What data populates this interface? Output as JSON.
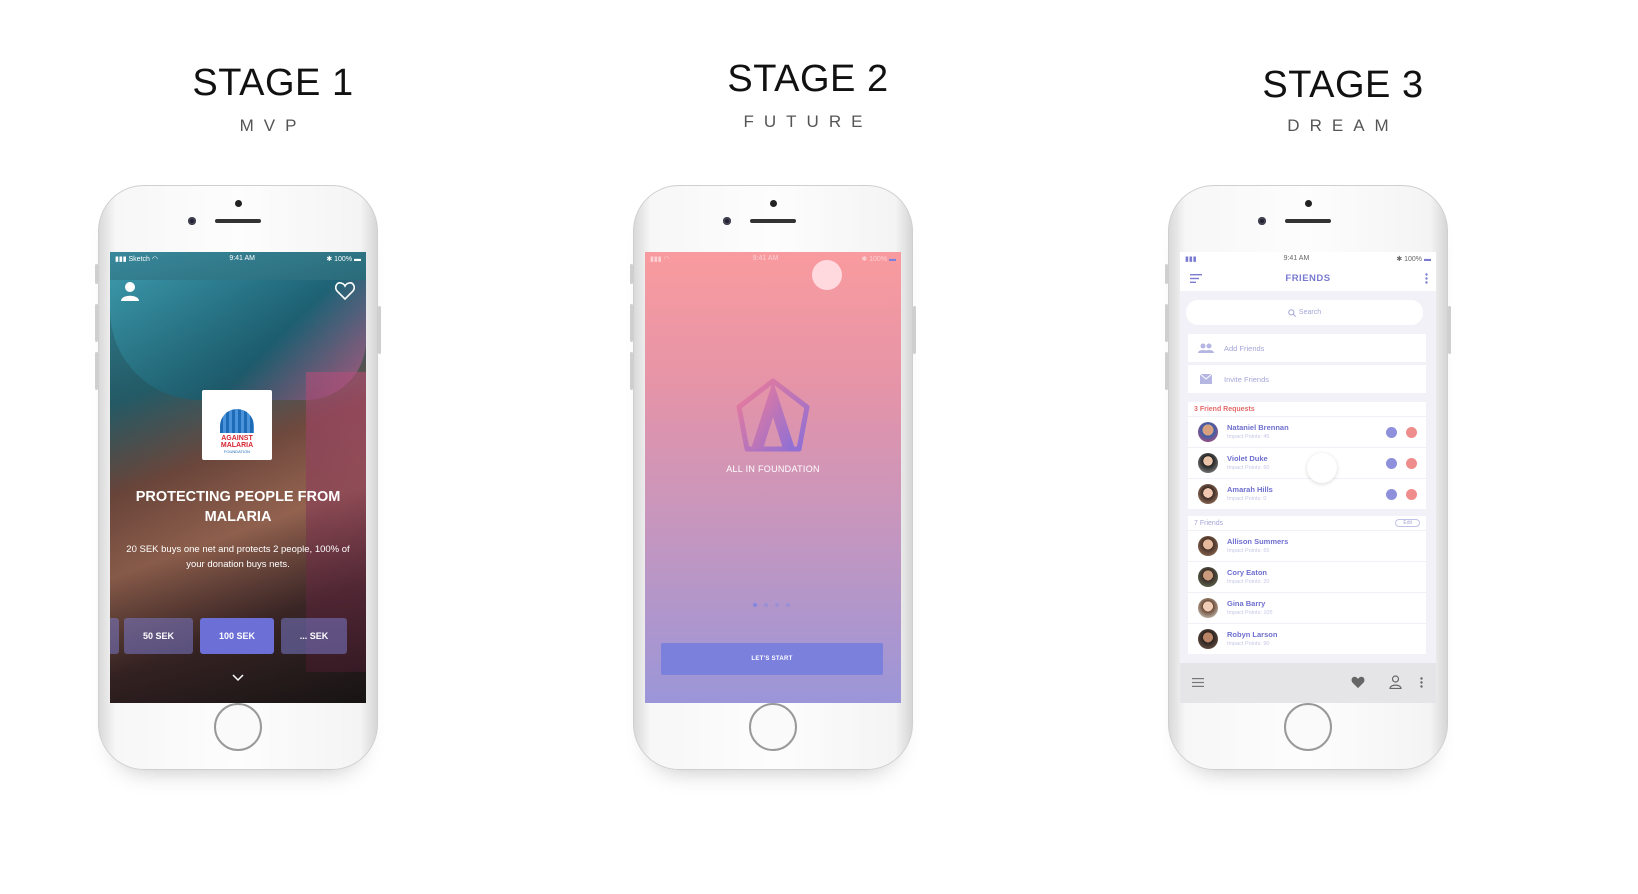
{
  "stages": [
    {
      "title": "STAGE 1",
      "subtitle": "MVP"
    },
    {
      "title": "STAGE 2",
      "subtitle": "FUTURE"
    },
    {
      "title": "STAGE 3",
      "subtitle": "DREAM"
    }
  ],
  "stage1": {
    "status": {
      "carrier": "Sketch",
      "time": "9:41 AM",
      "battery": "100%"
    },
    "logo": {
      "line1": "AGAINST",
      "line2": "MALARIA",
      "line3": "FOUNDATION"
    },
    "headline": "PROTECTING PEOPLE FROM MALARIA",
    "description": "20 SEK buys one net and protects 2 people, 100% of your donation buys nets.",
    "amounts": [
      "50 SEK",
      "100 SEK",
      "... SEK"
    ],
    "selected_amount": "100 SEK"
  },
  "stage2": {
    "status": {
      "time": "9:41 AM",
      "battery": "100%"
    },
    "brand": "ALL IN FOUNDATION",
    "page_count": 4,
    "cta": "LET'S START"
  },
  "stage3": {
    "status": {
      "time": "9:41 AM",
      "battery": "100%"
    },
    "title": "FRIENDS",
    "search_placeholder": "Search",
    "options": [
      "Add Friends",
      "Invite Friends"
    ],
    "requests_header": "3 Friend Requests",
    "requests": [
      {
        "name": "Nataniel Brennan",
        "points": "Impact Points: 45"
      },
      {
        "name": "Violet Duke",
        "points": "Impact Points: 60"
      },
      {
        "name": "Amarah Hills",
        "points": "Impact Points: 0"
      }
    ],
    "friends_header": "7 Friends",
    "edit_label": "Edit",
    "friends": [
      {
        "name": "Allison Summers",
        "points": "Impact Points: 65"
      },
      {
        "name": "Cory Eaton",
        "points": "Impact Points: 20"
      },
      {
        "name": "Gina Barry",
        "points": "Impact Points: 105"
      },
      {
        "name": "Robyn Larson",
        "points": "Impact Points: 90"
      }
    ],
    "accent": "#7a7bd1",
    "decline_color": "#ef8d8d"
  }
}
